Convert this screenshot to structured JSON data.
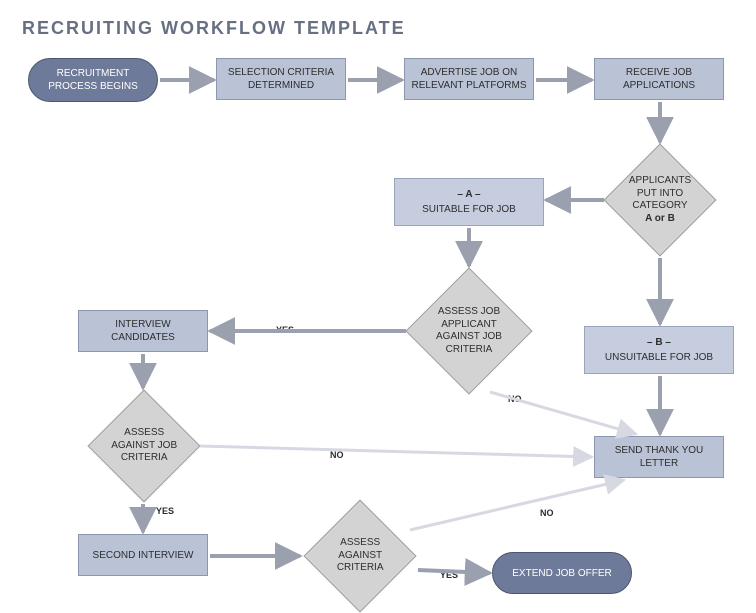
{
  "title": "RECRUITING WORKFLOW TEMPLATE",
  "nodes": {
    "start": "RECRUITMENT PROCESS BEGINS",
    "criteria": "SELECTION CRITERIA DETERMINED",
    "advertise": "ADVERTISE JOB ON RELEVANT PLATFORMS",
    "receive": "RECEIVE JOB APPLICATIONS",
    "categorize_l1": "APPLICANTS",
    "categorize_l2": "PUT INTO",
    "categorize_l3": "CATEGORY",
    "categorize_l4": "A or B",
    "catA_label": "– A –",
    "catA_text": "SUITABLE FOR JOB",
    "catB_label": "– B –",
    "catB_text": "UNSUITABLE FOR JOB",
    "assessA_l1": "ASSESS JOB",
    "assessA_l2": "APPLICANT",
    "assessA_l3": "AGAINST JOB",
    "assessA_l4": "CRITERIA",
    "interview": "INTERVIEW CANDIDATES",
    "assess2_l1": "ASSESS",
    "assess2_l2": "AGAINST JOB",
    "assess2_l3": "CRITERIA",
    "second": "SECOND INTERVIEW",
    "assess3_l1": "ASSESS",
    "assess3_l2": "AGAINST",
    "assess3_l3": "CRITERIA",
    "thankyou": "SEND THANK YOU LETTER",
    "offer": "EXTEND JOB OFFER"
  },
  "edge_labels": {
    "yes1": "YES",
    "no1": "NO",
    "yes2": "YES",
    "no2": "NO",
    "yes3": "YES",
    "no3": "NO"
  }
}
